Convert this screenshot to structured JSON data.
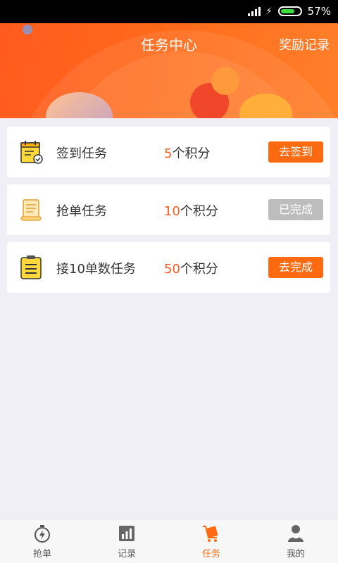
{
  "status_bar": {
    "battery": "57%"
  },
  "header": {
    "title": "任务中心",
    "reward_link": "奖励记录"
  },
  "tasks": [
    {
      "name": "签到任务",
      "points_num": "5",
      "points_unit": "个积分",
      "button": "去签到",
      "button_state": "active",
      "icon": "calendar-check-icon"
    },
    {
      "name": "抢单任务",
      "points_num": "10",
      "points_unit": "个积分",
      "button": "已完成",
      "button_state": "done",
      "icon": "scroll-document-icon"
    },
    {
      "name": "接10单数任务",
      "points_num": "50",
      "points_unit": "个积分",
      "button": "去完成",
      "button_state": "active",
      "icon": "clipboard-list-icon"
    }
  ],
  "tabbar": [
    {
      "label": "抢单",
      "icon": "stopwatch-icon",
      "active": false
    },
    {
      "label": "记录",
      "icon": "bar-chart-icon",
      "active": false
    },
    {
      "label": "任务",
      "icon": "cart-task-icon",
      "active": true
    },
    {
      "label": "我的",
      "icon": "person-icon",
      "active": false
    }
  ],
  "colors": {
    "accent": "#ff6a10",
    "header_start": "#ff5a1f",
    "header_end": "#ff7f2a",
    "done_gray": "#bdbdbd"
  }
}
